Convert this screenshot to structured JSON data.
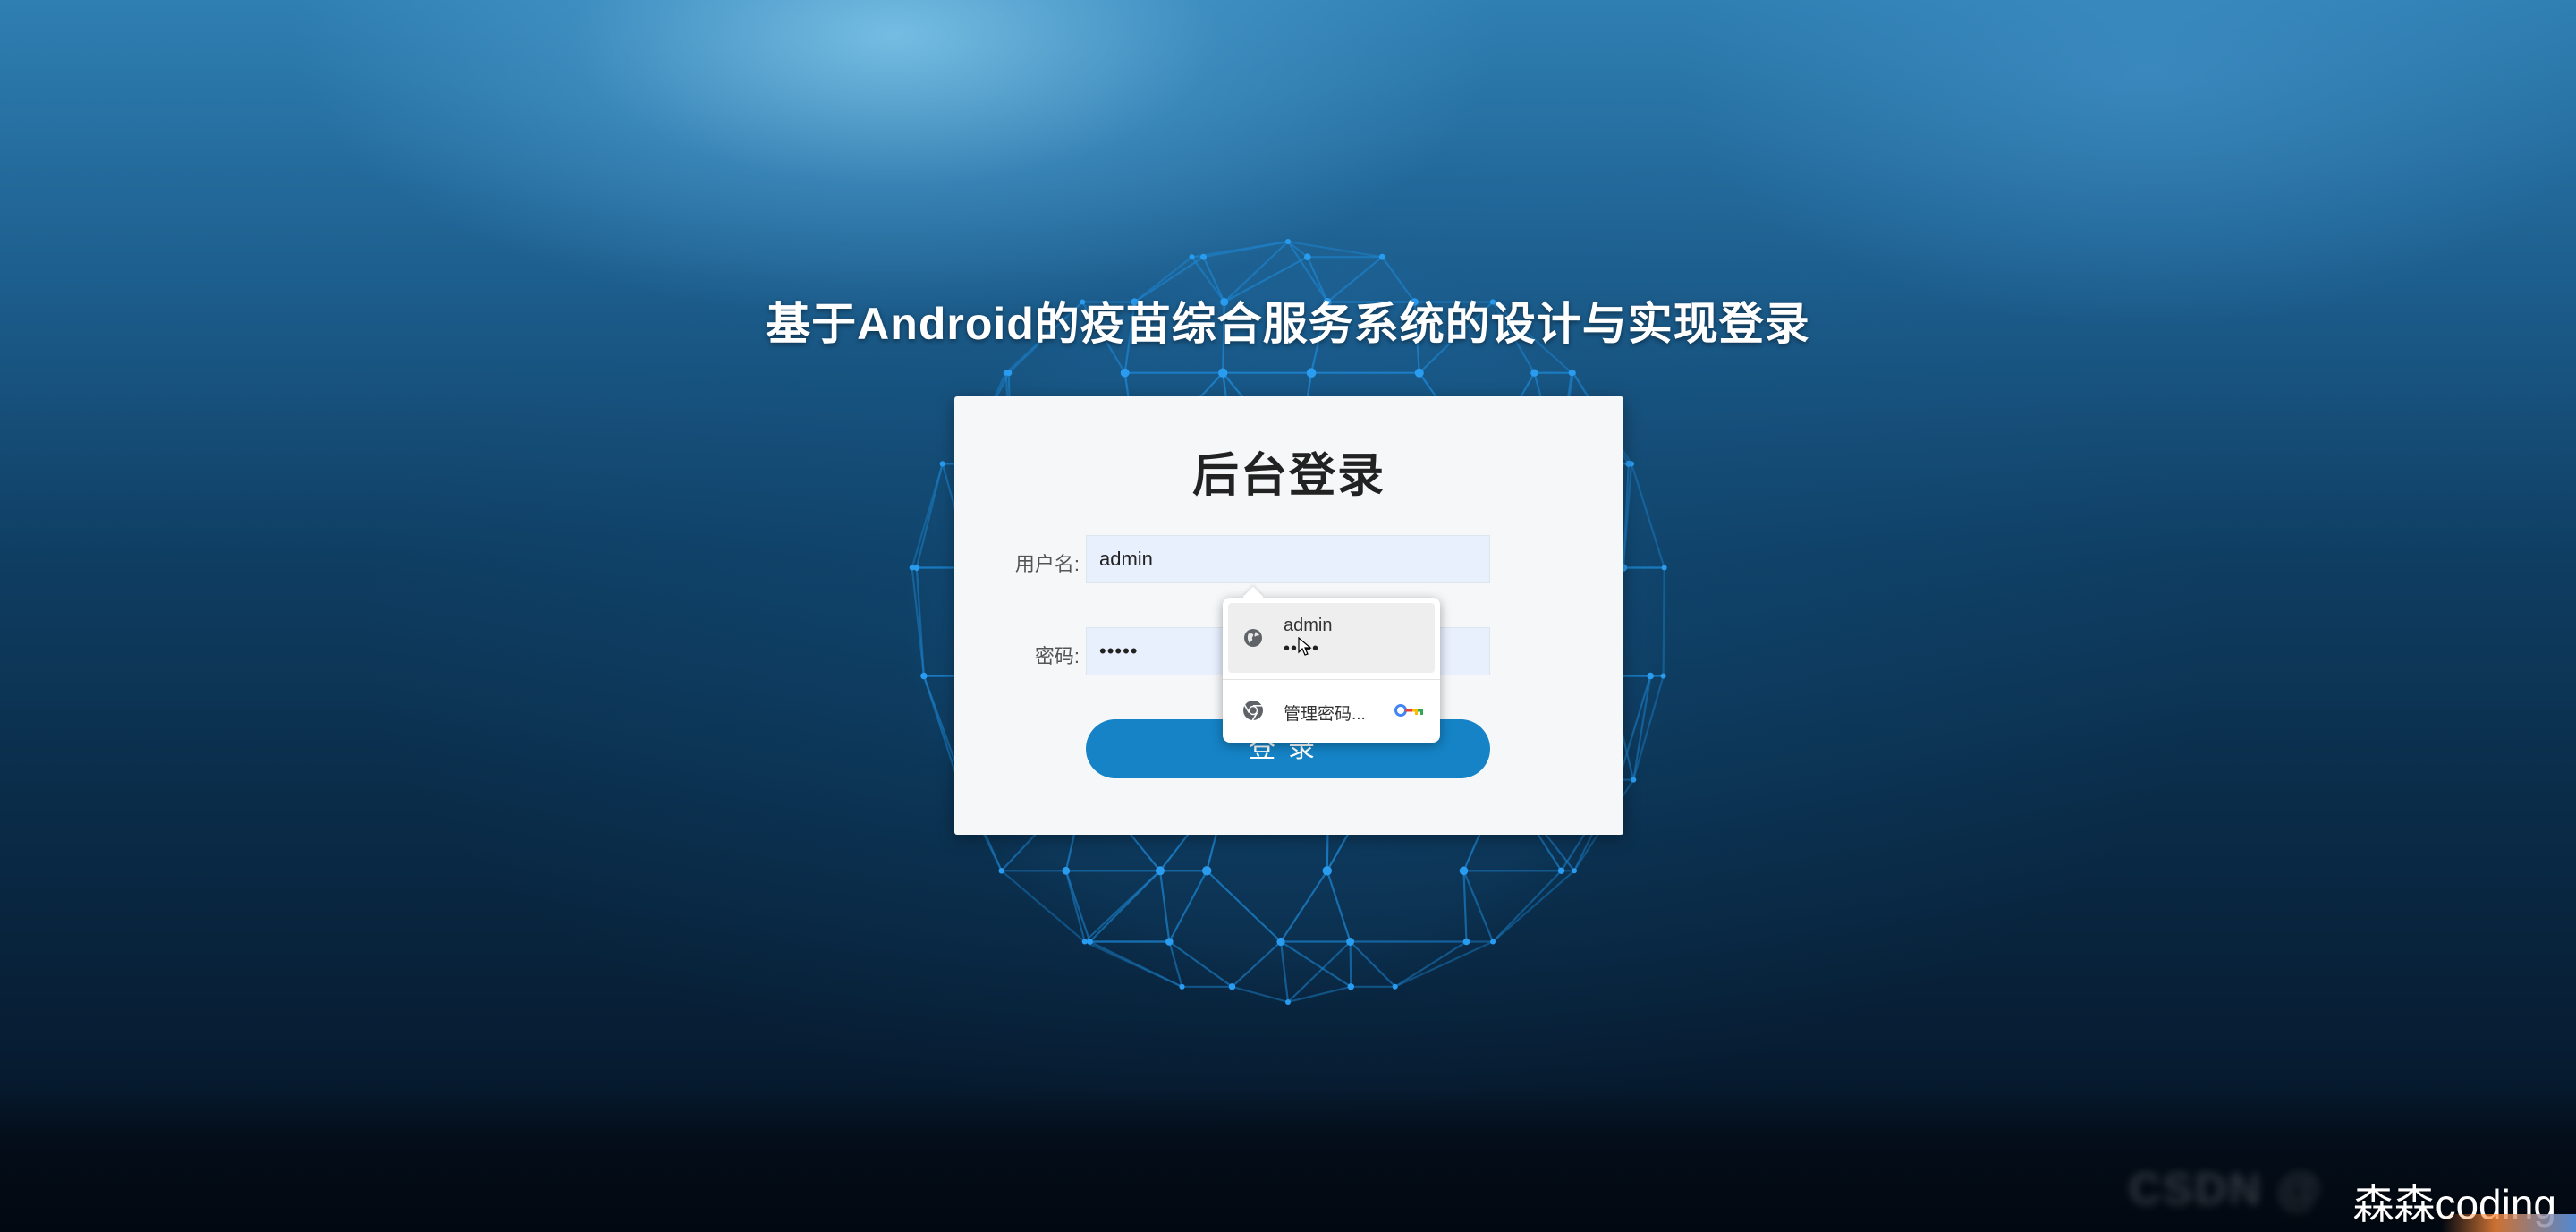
{
  "page": {
    "title": "基于Android的疫苗综合服务系统的设计与实现登录"
  },
  "login_card": {
    "title": "后台登录",
    "username_label": "用户名:",
    "username_value": "admin",
    "password_label": "密码:",
    "password_value": "•••••",
    "submit_label": "登录"
  },
  "autofill": {
    "suggestion_username": "admin",
    "suggestion_password": "•••••",
    "manage_label": "管理密码..."
  },
  "watermark": {
    "text": "森森coding",
    "blurred_text": "CSDN @"
  },
  "colors": {
    "accent": "#1583c6",
    "globe_line": "#1f8fe0",
    "input_bg": "#e8f0fe"
  },
  "icons": {
    "globe": "globe-icon",
    "chrome": "chrome-icon",
    "key": "key-icon",
    "cursor": "cursor-icon"
  }
}
